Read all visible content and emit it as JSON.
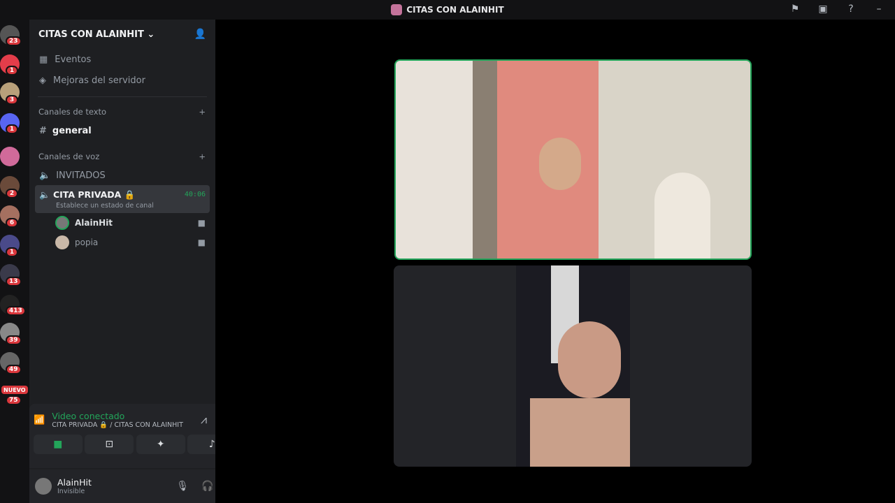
{
  "window": {
    "title": "CITAS CON ALAINHIT"
  },
  "rail": {
    "badges": [
      "23",
      "1",
      "3",
      "1",
      "",
      "2",
      "6",
      "1",
      "13",
      "413",
      "39",
      "49"
    ],
    "nuevo": "NUEVO",
    "nuevo_count": "75"
  },
  "server": {
    "name": "CITAS CON ALAINHIT"
  },
  "menu": {
    "events": "Eventos",
    "boosts": "Mejoras del servidor"
  },
  "text_category": "Canales de texto",
  "text_channels": [
    "general"
  ],
  "voice_category": "Canales de voz",
  "voice_channels": [
    {
      "name": "INVITADOS"
    },
    {
      "name": "CITA PRIVADA",
      "timer": "40:06",
      "status": "Establece un estado de canal"
    }
  ],
  "voice_users": [
    "AlainHit",
    "popia"
  ],
  "voice_connection": {
    "status": "Video conectado",
    "location": "CITA PRIVADA 🔒 / CITAS CON ALAINHIT"
  },
  "user": {
    "name": "AlainHit",
    "status": "Invisible"
  },
  "colors": {
    "green": "#23a55a",
    "red": "#da373c",
    "bg": "#1e1f22"
  }
}
